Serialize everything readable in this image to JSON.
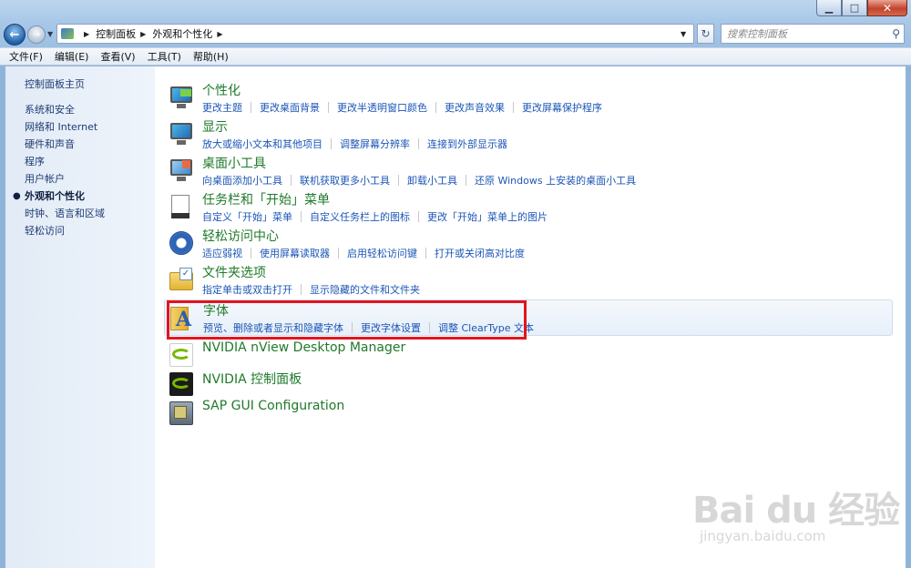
{
  "window": {
    "minimize_glyph": "▁",
    "maximize_glyph": "□",
    "close_glyph": "✕"
  },
  "nav": {
    "back_glyph": "←",
    "forward_glyph": "→",
    "breadcrumb": [
      "控制面板",
      "外观和个性化"
    ],
    "search_placeholder": "搜索控制面板",
    "refresh_glyph": "↻",
    "search_glyph": "⚲"
  },
  "menubar": [
    {
      "label": "文件(F)"
    },
    {
      "label": "编辑(E)"
    },
    {
      "label": "查看(V)"
    },
    {
      "label": "工具(T)"
    },
    {
      "label": "帮助(H)"
    }
  ],
  "sidebar": {
    "home": "控制面板主页",
    "items": [
      {
        "label": "系统和安全",
        "active": false
      },
      {
        "label": "网络和 Internet",
        "active": false
      },
      {
        "label": "硬件和声音",
        "active": false
      },
      {
        "label": "程序",
        "active": false
      },
      {
        "label": "用户帐户",
        "active": false
      },
      {
        "label": "外观和个性化",
        "active": true
      },
      {
        "label": "时钟、语言和区域",
        "active": false
      },
      {
        "label": "轻松访问",
        "active": false
      }
    ]
  },
  "categories": [
    {
      "title": "个性化",
      "icon": "personalization-icon",
      "links": [
        "更改主题",
        "更改桌面背景",
        "更改半透明窗口颜色",
        "更改声音效果",
        "更改屏幕保护程序"
      ]
    },
    {
      "title": "显示",
      "icon": "display-icon",
      "links": [
        "放大或缩小文本和其他项目",
        "调整屏幕分辨率",
        "连接到外部显示器"
      ]
    },
    {
      "title": "桌面小工具",
      "icon": "gadgets-icon",
      "links": [
        "向桌面添加小工具",
        "联机获取更多小工具",
        "卸载小工具",
        "还原 Windows 上安装的桌面小工具"
      ]
    },
    {
      "title": "任务栏和「开始」菜单",
      "icon": "taskbar-icon",
      "links": [
        "自定义「开始」菜单",
        "自定义任务栏上的图标",
        "更改「开始」菜单上的图片"
      ]
    },
    {
      "title": "轻松访问中心",
      "icon": "ease-of-access-icon",
      "links": [
        "适应弱视",
        "使用屏幕读取器",
        "启用轻松访问键",
        "打开或关闭高对比度"
      ]
    },
    {
      "title": "文件夹选项",
      "icon": "folder-options-icon",
      "links": [
        "指定单击或双击打开",
        "显示隐藏的文件和文件夹"
      ]
    },
    {
      "title": "字体",
      "icon": "fonts-icon",
      "links": [
        "预览、删除或者显示和隐藏字体",
        "更改字体设置",
        "调整 ClearType 文本"
      ]
    }
  ],
  "extras": [
    {
      "title": "NVIDIA nView Desktop Manager",
      "icon": "nvidia-icon"
    },
    {
      "title": "NVIDIA 控制面板",
      "icon": "nvidia-icon"
    },
    {
      "title": "SAP GUI Configuration",
      "icon": "sap-icon"
    }
  ],
  "colors": {
    "link": "#1c56b6",
    "category_title": "#1f7a2a",
    "highlight_box": "#e3141f"
  },
  "watermark": {
    "logo": "Bai du 经验",
    "url": "jingyan.baidu.com"
  }
}
